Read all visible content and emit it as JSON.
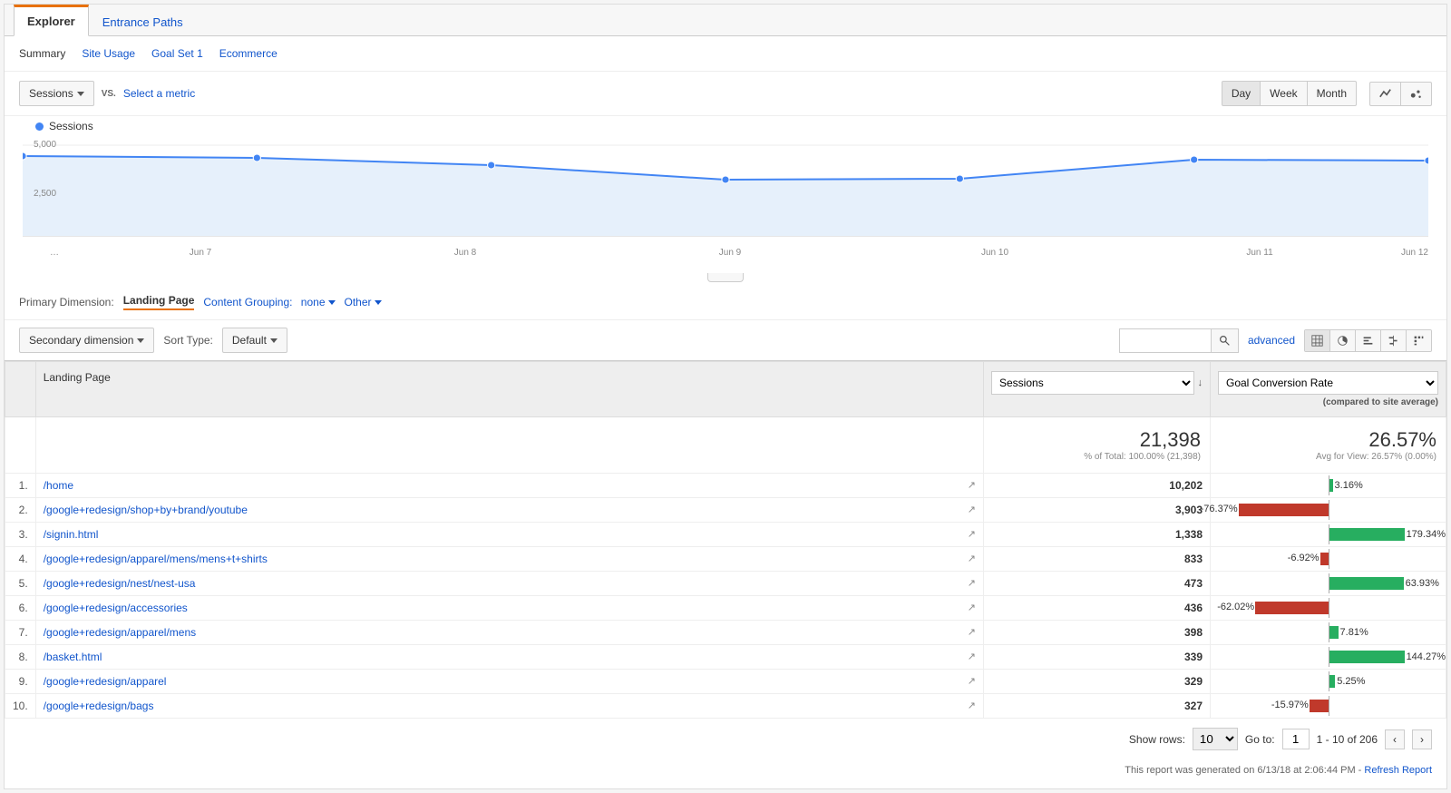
{
  "tabs": {
    "explorer": "Explorer",
    "entrance": "Entrance Paths"
  },
  "subtabs": {
    "summary": "Summary",
    "site_usage": "Site Usage",
    "goal1": "Goal Set 1",
    "ecom": "Ecommerce"
  },
  "toolbar": {
    "metric1": "Sessions",
    "vs": "VS.",
    "select_metric": "Select a metric",
    "day": "Day",
    "week": "Week",
    "month": "Month"
  },
  "chart": {
    "legend": "Sessions",
    "y1": "5,000",
    "y2": "2,500"
  },
  "chart_data": {
    "type": "line",
    "title": "Sessions",
    "xlabel": "",
    "ylabel": "",
    "ylim": [
      0,
      5000
    ],
    "categories": [
      "…",
      "Jun 7",
      "Jun 8",
      "Jun 9",
      "Jun 10",
      "Jun 11",
      "Jun 12"
    ],
    "series": [
      {
        "name": "Sessions",
        "values": [
          4400,
          4300,
          3900,
          3100,
          3150,
          4200,
          4150
        ]
      }
    ]
  },
  "dim": {
    "primary_label": "Primary Dimension:",
    "primary_value": "Landing Page",
    "grouping_label": "Content Grouping:",
    "grouping_value": "none",
    "other": "Other"
  },
  "sec": {
    "secondary": "Secondary dimension",
    "sort_label": "Sort Type:",
    "sort_value": "Default",
    "advanced": "advanced"
  },
  "table": {
    "header_page": "Landing Page",
    "metric_select": "Sessions",
    "conv_select": "Goal Conversion Rate",
    "compare_sub": "(compared to site average)",
    "total_sessions": "21,398",
    "total_sessions_sub": "% of Total: 100.00% (21,398)",
    "total_conv": "26.57%",
    "total_conv_sub": "Avg for View: 26.57% (0.00%)",
    "rows": [
      {
        "n": "1.",
        "page": "/home",
        "sessions": "10,202",
        "pct": "3.16%",
        "val": 3.16
      },
      {
        "n": "2.",
        "page": "/google+redesign/shop+by+brand/youtube",
        "sessions": "3,903",
        "pct": "-76.37%",
        "val": -76.37
      },
      {
        "n": "3.",
        "page": "/signin.html",
        "sessions": "1,338",
        "pct": "179.34%",
        "val": 179.34
      },
      {
        "n": "4.",
        "page": "/google+redesign/apparel/mens/mens+t+shirts",
        "sessions": "833",
        "pct": "-6.92%",
        "val": -6.92
      },
      {
        "n": "5.",
        "page": "/google+redesign/nest/nest-usa",
        "sessions": "473",
        "pct": "63.93%",
        "val": 63.93
      },
      {
        "n": "6.",
        "page": "/google+redesign/accessories",
        "sessions": "436",
        "pct": "-62.02%",
        "val": -62.02
      },
      {
        "n": "7.",
        "page": "/google+redesign/apparel/mens",
        "sessions": "398",
        "pct": "7.81%",
        "val": 7.81
      },
      {
        "n": "8.",
        "page": "/basket.html",
        "sessions": "339",
        "pct": "144.27%",
        "val": 144.27
      },
      {
        "n": "9.",
        "page": "/google+redesign/apparel",
        "sessions": "329",
        "pct": "5.25%",
        "val": 5.25
      },
      {
        "n": "10.",
        "page": "/google+redesign/bags",
        "sessions": "327",
        "pct": "-15.97%",
        "val": -15.97
      }
    ]
  },
  "footer": {
    "show_rows": "Show rows:",
    "rows_val": "10",
    "goto": "Go to:",
    "goto_val": "1",
    "range": "1 - 10 of 206",
    "report_text": "This report was generated on 6/13/18 at 2:06:44 PM - ",
    "refresh": "Refresh Report"
  }
}
